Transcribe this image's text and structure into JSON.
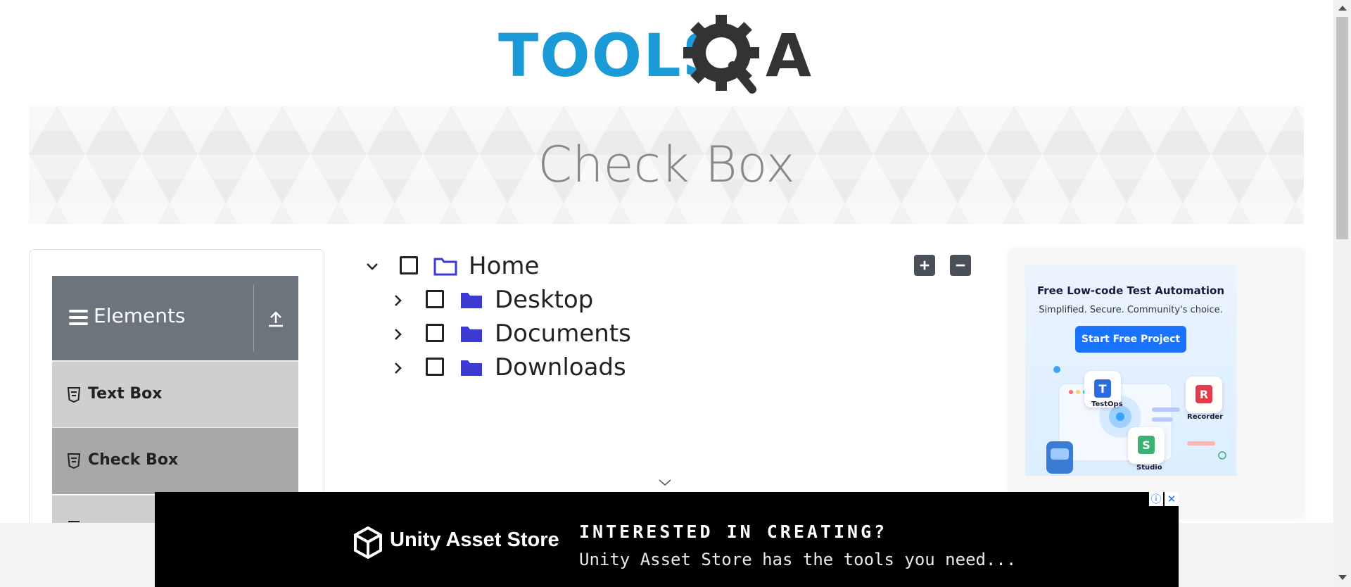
{
  "header": {
    "logo_text": "TOOLSQA"
  },
  "banner": {
    "title": "Check Box"
  },
  "sidebar": {
    "group_label": "Elements",
    "items": [
      {
        "label": "Text Box"
      },
      {
        "label": "Check Box"
      }
    ]
  },
  "tree": {
    "root": {
      "label": "Home",
      "expanded": true,
      "checked": false
    },
    "children": [
      {
        "label": "Desktop",
        "expanded": false,
        "checked": false
      },
      {
        "label": "Documents",
        "expanded": false,
        "checked": false
      },
      {
        "label": "Downloads",
        "expanded": false,
        "checked": false
      }
    ],
    "expand_all_icon": "plus-icon",
    "collapse_all_icon": "minus-icon"
  },
  "side_ad": {
    "title": "Free Low-code Test Automation",
    "subtitle": "Simplified. Secure. Community's choice.",
    "cta": "Start Free Project",
    "tiles": [
      "TestOps",
      "Recorder",
      "Studio"
    ]
  },
  "bottom_ad": {
    "brand": "Unity Asset Store",
    "headline": "INTERESTED IN CREATING?",
    "subline": "Unity Asset Store has the tools you need..."
  },
  "colors": {
    "logo_blue": "#1a9ad6",
    "logo_dark": "#333333",
    "sidebar_header": "#6c757d",
    "folder": "#3b3bd4",
    "tree_button": "#495057",
    "ad_cta": "#1a73ff"
  }
}
